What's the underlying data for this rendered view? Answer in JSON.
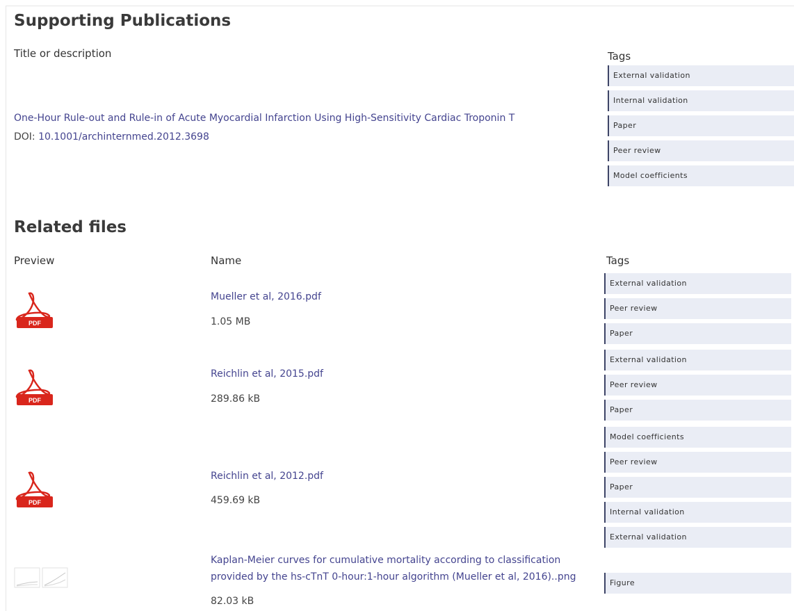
{
  "publications": {
    "heading": "Supporting Publications",
    "title_col": "Title or description",
    "tags_col": "Tags",
    "items": [
      {
        "title": "One-Hour Rule-out and Rule-in of Acute Myocardial Infarction Using High-Sensitivity Cardiac Troponin T",
        "doi_label": "DOI:",
        "doi": "10.1001/archinternmed.2012.3698",
        "tags": [
          "External validation",
          "Internal validation",
          "Paper",
          "Peer review",
          "Model coefficients"
        ]
      }
    ]
  },
  "files": {
    "heading": "Related files",
    "preview_col": "Preview",
    "name_col": "Name",
    "tags_col": "Tags",
    "pdf_badge": "PDF",
    "items": [
      {
        "name": "Mueller et al, 2016.pdf",
        "size": "1.05 MB",
        "icon": "pdf-icon",
        "tags": [
          "External validation",
          "Peer review",
          "Paper"
        ]
      },
      {
        "name": "Reichlin et al, 2015.pdf",
        "size": "289.86 kB",
        "icon": "pdf-icon",
        "tags": [
          "External validation",
          "Peer review",
          "Paper"
        ]
      },
      {
        "name": "Reichlin et al, 2012.pdf",
        "size": "459.69 kB",
        "icon": "pdf-icon",
        "tags": [
          "Model coefficients",
          "Peer review",
          "Paper",
          "Internal validation",
          "External validation"
        ]
      },
      {
        "name_line1": "Kaplan-Meier curves for cumulative mortality according to classification",
        "name_line2": "provided by the hs-cTnT 0-hour:1-hour algorithm (Mueller et al, 2016)..png",
        "size": "82.03 kB",
        "icon": "image-thumbnail",
        "tags": [
          "Figure"
        ]
      }
    ]
  },
  "colors": {
    "link": "#44448f",
    "tag_bg": "#eaedf5",
    "tag_border": "#3d4466",
    "pdf_red": "#d9261c"
  }
}
